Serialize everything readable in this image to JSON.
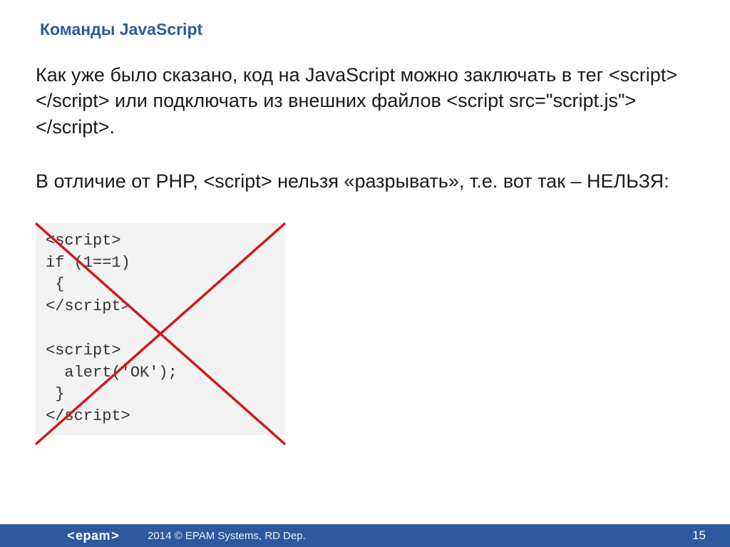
{
  "title": "Команды JavaScript",
  "paragraph1": "Как уже было сказано, код на JavaScript можно заключать в тег <script></script> или подключать из внешних файлов <script src=\"script.js\"></script>.",
  "paragraph2": "В отличие от PHP, <script> нельзя «разрывать», т.е. вот так – НЕЛЬЗЯ:",
  "code": "<script>\nif (1==1)\n {\n</script>\n\n<script>\n  alert('OK');\n }\n</script>",
  "footer": {
    "brand": "epam",
    "copyright": "2014 © EPAM Systems, RD Dep.",
    "page": "15"
  },
  "colors": {
    "accent": "#2d5a9e",
    "cross": "#d11a1a",
    "codeBg": "#f3f3f3"
  }
}
